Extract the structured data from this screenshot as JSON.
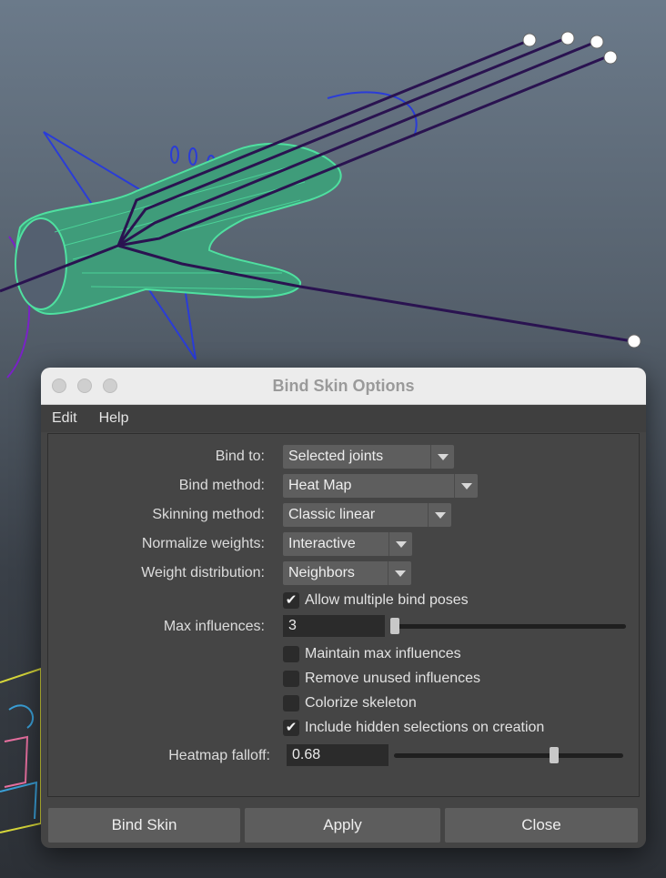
{
  "dialog": {
    "title": "Bind Skin Options",
    "menu": [
      "Edit",
      "Help"
    ],
    "options": {
      "bind_to": {
        "label": "Bind to:",
        "value": "Selected joints"
      },
      "bind_method": {
        "label": "Bind method:",
        "value": "Heat Map"
      },
      "skinning_method": {
        "label": "Skinning method:",
        "value": "Classic linear"
      },
      "normalize_weights": {
        "label": "Normalize weights:",
        "value": "Interactive"
      },
      "weight_distribution": {
        "label": "Weight distribution:",
        "value": "Neighbors"
      },
      "allow_multiple_bind_poses": {
        "label": "Allow multiple bind poses",
        "checked": true
      },
      "max_influences": {
        "label": "Max influences:",
        "value": "3",
        "slider_fraction": 0.0
      },
      "maintain_max_influences": {
        "label": "Maintain max influences",
        "checked": false
      },
      "remove_unused_influences": {
        "label": "Remove unused influences",
        "checked": false
      },
      "colorize_skeleton": {
        "label": "Colorize skeleton",
        "checked": false
      },
      "include_hidden_selections": {
        "label": "Include hidden selections on creation",
        "checked": true
      },
      "heatmap_falloff": {
        "label": "Heatmap falloff:",
        "value": "0.68",
        "slider_fraction": 0.68
      }
    },
    "buttons": {
      "bind_skin": "Bind Skin",
      "apply": "Apply",
      "close": "Close"
    }
  },
  "colors": {
    "mesh_wireframe": "#4fe0a0",
    "joint_lines": "#2a1350",
    "control_curves": "#2a3cd8",
    "dialog_bg": "#444444",
    "titlebar_bg": "#ececec"
  }
}
